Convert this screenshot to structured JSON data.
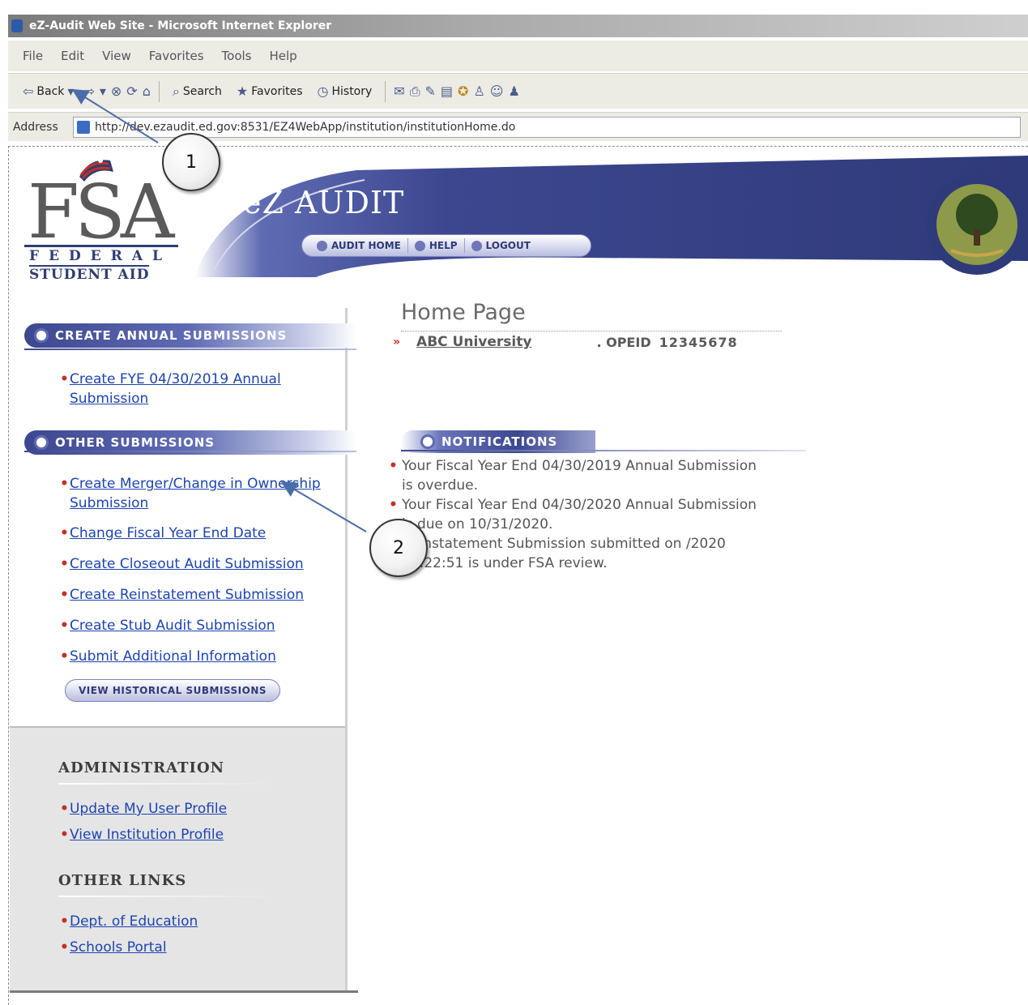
{
  "browser": {
    "window_title": "eZ-Audit Web Site - Microsoft Internet Explorer",
    "menu": [
      "File",
      "Edit",
      "View",
      "Favorites",
      "Tools",
      "Help"
    ],
    "toolbar": {
      "back_label": "Back",
      "search_label": "Search",
      "favorites_label": "Favorites",
      "history_label": "History"
    },
    "address_label": "Address",
    "url": "http://dev.ezaudit.ed.gov:8531/EZ4WebApp/institution/institutionHome.do"
  },
  "header": {
    "logo_letters": "FSA",
    "logo_line1": "FEDERAL",
    "logo_line2": "STUDENT AID",
    "app_title": "eZ AUDIT",
    "nav": [
      "AUDIT HOME",
      "HELP",
      "LOGOUT"
    ]
  },
  "sidebar": {
    "create_annual_heading": "CREATE ANNUAL SUBMISSIONS",
    "annual_links": [
      "Create FYE 04/30/2019 Annual Submission"
    ],
    "other_heading": "OTHER SUBMISSIONS",
    "other_links": [
      "Create Merger/Change in Ownership Submission",
      "Change Fiscal Year End Date",
      "Create Closeout Audit Submission",
      "Create Reinstatement Submission",
      "Create Stub Audit Submission",
      "Submit Additional Information"
    ],
    "historical_button": "VIEW HISTORICAL SUBMISSIONS",
    "administration_heading": "ADMINISTRATION",
    "admin_links": [
      "Update My User Profile",
      "View Institution Profile"
    ],
    "other_links_heading": "OTHER LINKS",
    "external_links": [
      "Dept. of Education",
      "Schools Portal"
    ]
  },
  "main": {
    "page_title": "Home Page",
    "institution_name": "ABC University",
    "opeid_label": ". OPEID",
    "opeid_value": "12345678",
    "notifications_heading": "NOTIFICATIONS",
    "notifications": [
      "Your Fiscal Year End 04/30/2019 Annual Submission is overdue.",
      "Your Fiscal Year End 04/30/2020 Annual Submission is due on 10/31/2020.",
      "Reinstatement Submission submitted on /2020 11:22:51 is under FSA review."
    ]
  },
  "callouts": [
    "1",
    "2"
  ],
  "colors": {
    "link": "#1d44b0",
    "bullet": "#c0322a",
    "banner": "#2f3a7a"
  }
}
